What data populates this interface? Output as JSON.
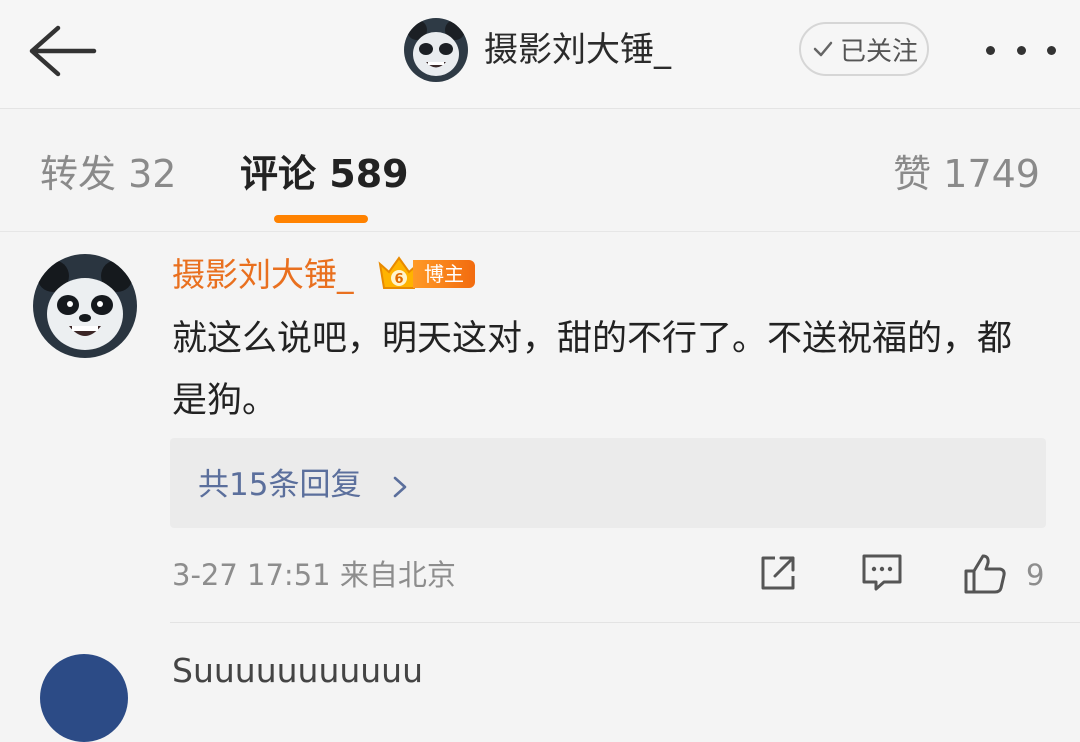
{
  "header": {
    "back_icon": "arrow-left-icon",
    "username": "摄影刘大锤_",
    "follow_label": "已关注",
    "more_icon": "more-dots-icon"
  },
  "tabs": {
    "repost_label": "转发",
    "repost_count": "32",
    "comment_label": "评论",
    "comment_count": "589",
    "like_label": "赞",
    "like_count": "1749",
    "active": "comment",
    "accent_color": "#ff8200"
  },
  "comment": {
    "username": "摄影刘大锤_",
    "badge_level": "6",
    "badge_label": "博主",
    "text": "就这么说吧，明天这对，甜的不行了。不送祝福的，都是狗。",
    "replies_label": "共15条回复",
    "timestamp": "3-27 17:51",
    "location": "来自北京",
    "likes": "9",
    "name_color": "#e9701f",
    "link_color": "#5b6f9c"
  },
  "next_comment": {
    "username": "Suuuuuuuuuuu"
  }
}
